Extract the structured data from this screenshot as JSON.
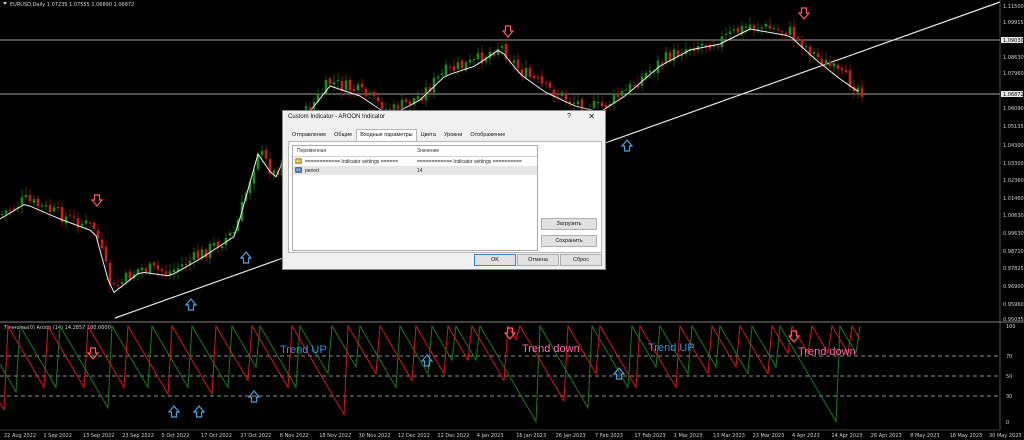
{
  "chart": {
    "symbol_line": "EURUSD,Daily  1.07235 1.07555 1.06890 1.06872",
    "indicator_line": "Точно вы(0) Aroon (14) 14.2857 100.0000",
    "price_labels": [
      "1.11500",
      "1.09915",
      "1.09030",
      "1.08630",
      "1.07960",
      "1.06872",
      "1.06090",
      "1.05135",
      "1.04300",
      "1.03300",
      "1.02360",
      "1.01460",
      "1.00630",
      "0.99630",
      "0.98710",
      "0.97825",
      "0.96900",
      "0.95960",
      "0.95035"
    ],
    "date_labels": [
      "22 Aug 2022",
      "1 Sep 2022",
      "13 Sep 2022",
      "23 Sep 2022",
      "5 Oct 2022",
      "17 Oct 2022",
      "27 Oct 2022",
      "8 Nov 2022",
      "18 Nov 2022",
      "30 Nov 2022",
      "12 Dec 2022",
      "22 Dec 2022",
      "4 Jan 2023",
      "16 Jan 2023",
      "26 Jan 2023",
      "7 Feb 2023",
      "17 Feb 2023",
      "1 Mar 2023",
      "13 Mar 2023",
      "23 Mar 2023",
      "4 Apr 2023",
      "14 Apr 2023",
      "26 Apr 2023",
      "8 May 2023",
      "18 May 2023",
      "30 May 2023"
    ],
    "aroon_levels": [
      "100",
      "70",
      "50",
      "30",
      "0"
    ],
    "trend_labels": [
      {
        "text": "Trend UP",
        "color": "#3d8fe0"
      },
      {
        "text": "Trend down",
        "color": "#ff6fa8"
      },
      {
        "text": "Trend UP",
        "color": "#3d8fe0"
      },
      {
        "text": "Trend down",
        "color": "#ff6fa8"
      }
    ],
    "colors": {
      "bull": "#1f8a1f",
      "bear": "#c81e1e",
      "ma": "#ffffff",
      "arrow_up": "#4aa3df",
      "arrow_down": "#ff5a5a",
      "aroon_up": "#1e7a1e",
      "aroon_down": "#d21a1a"
    }
  },
  "dialog": {
    "title": "Custom Indicator - AROON Indicator",
    "help": "?",
    "close": "✕",
    "tabs": [
      "Отправление",
      "Общие",
      "Входные параметры",
      "Цвета",
      "Уровни",
      "Отображение"
    ],
    "active_tab": 2,
    "columns": [
      "Переменная",
      "Значение"
    ],
    "rows": [
      {
        "icon": "ab",
        "variable": "============ Indicator settings ======",
        "value": "============ Indicator settings =========="
      },
      {
        "icon": "01",
        "variable": "period",
        "value": "14"
      }
    ],
    "load_btn": "Загрузить",
    "save_btn": "Сохранить",
    "ok_btn": "OK",
    "cancel_btn": "Отмена",
    "reset_btn": "Сброс"
  }
}
